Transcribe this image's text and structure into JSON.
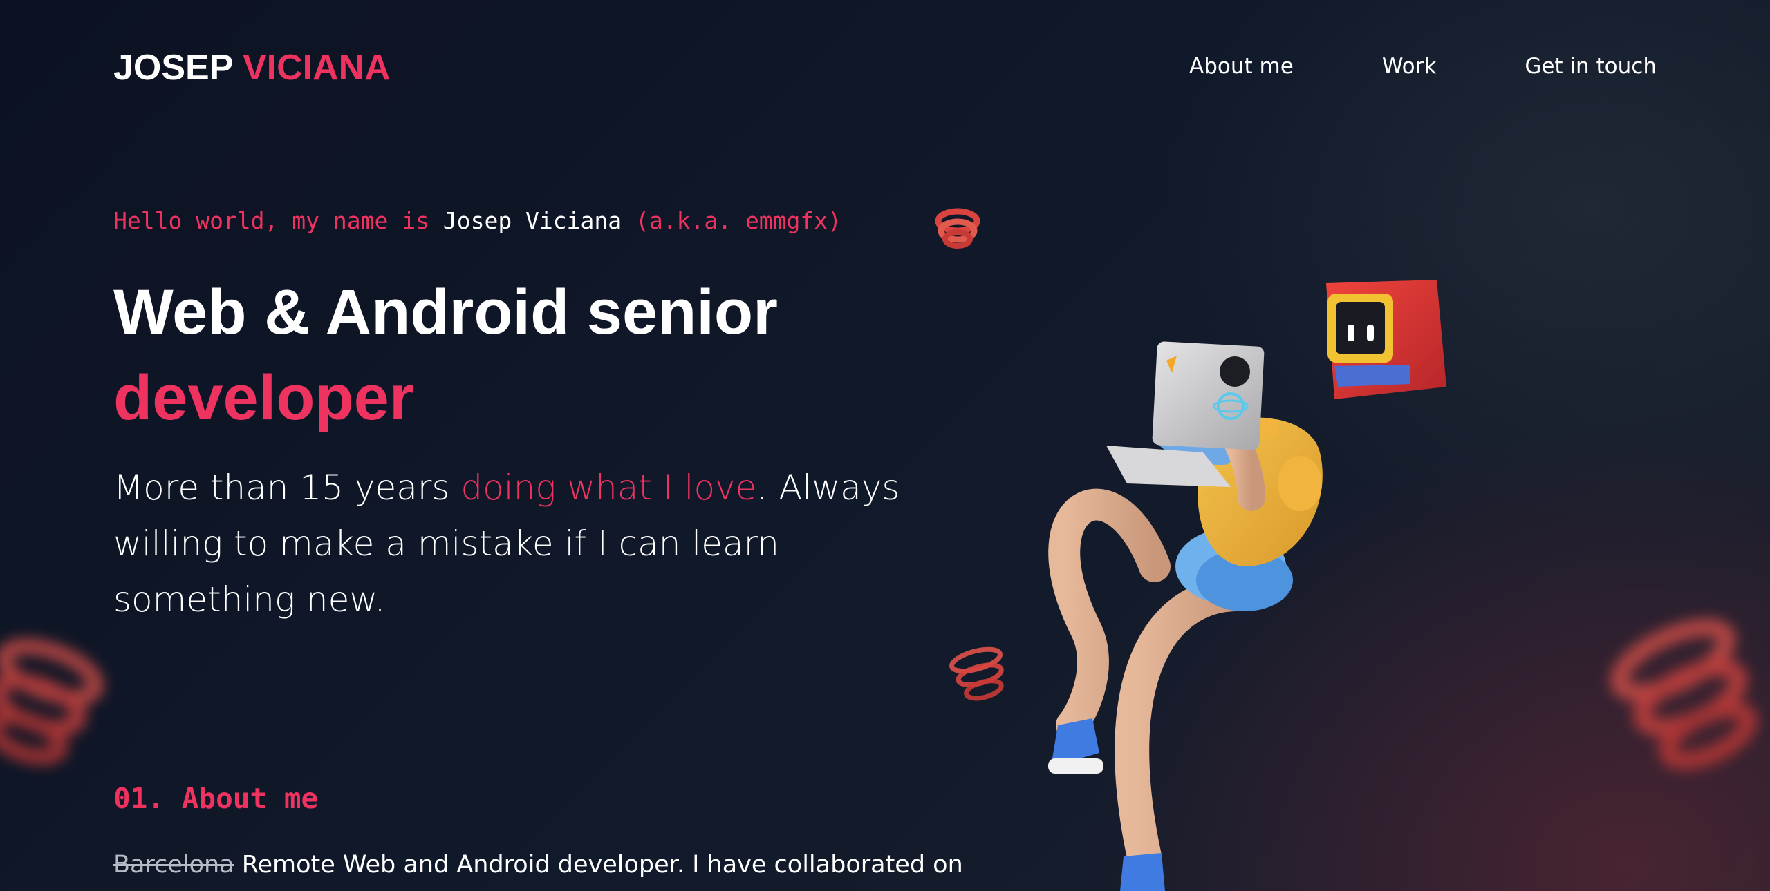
{
  "header": {
    "logo_first": "JOSEP",
    "logo_last": "VICIANA",
    "nav": [
      "About me",
      "Work",
      "Get in touch"
    ]
  },
  "hero": {
    "hello_prefix": "Hello world, my name is",
    "hello_name": "Josep Viciana",
    "hello_aka": "(a.k.a. emmgfx)",
    "headline_line1": "Web & Android senior",
    "headline_line2": "developer",
    "intro_start": "More than 15 years",
    "intro_accent": "doing what I love",
    "intro_end": ". Always willing to make a mistake if I can learn something new."
  },
  "about": {
    "section_title": "01. About me",
    "struck_word": "Barcelona",
    "text": "Remote Web and Android developer. I have collaborated on"
  },
  "colors": {
    "accent": "#ee3360",
    "background": "#0e1424",
    "text": "#ffffff"
  },
  "icons": {
    "hero_illustration": "developer-character-illustration",
    "decor": "spiral-decoration"
  }
}
